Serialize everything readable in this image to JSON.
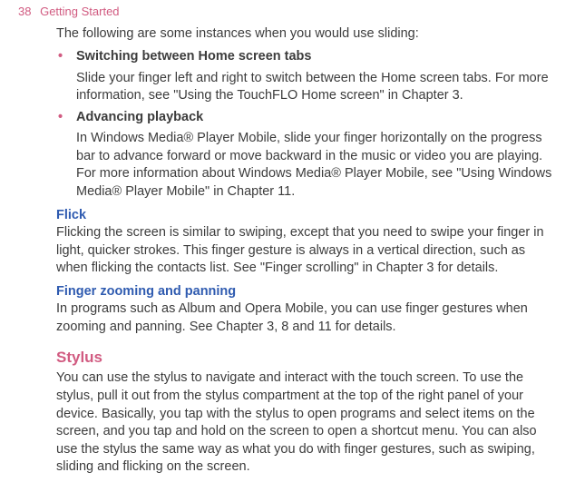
{
  "header": {
    "page_number": "38",
    "section": "Getting Started"
  },
  "intro": "The following are some instances when you would use sliding:",
  "bullets": [
    {
      "title": "Switching between Home screen tabs",
      "body": "Slide your finger left and right to switch between the Home screen tabs. For more information, see \"Using the TouchFLO Home screen\" in Chapter 3."
    },
    {
      "title": "Advancing playback",
      "body": "In Windows Media® Player Mobile, slide your finger horizontally on the progress bar to advance forward or move backward in the music or video you are playing. For more information about Windows Media® Player Mobile, see \"Using Windows Media® Player Mobile\" in Chapter 11."
    }
  ],
  "flick": {
    "heading": "Flick",
    "body": "Flicking the screen is similar to swiping, except that you need to swipe your finger in light, quicker strokes. This finger gesture is always in a vertical direction, such as when flicking the contacts list. See \"Finger scrolling\" in Chapter 3 for details."
  },
  "fzp": {
    "heading": "Finger zooming and panning",
    "body": "In programs such as Album and Opera Mobile, you can use finger gestures when zooming and panning. See Chapter 3, 8 and 11 for details."
  },
  "stylus": {
    "heading": "Stylus",
    "body": "You can use the stylus to navigate and interact with the touch screen. To use the stylus, pull it out from the stylus compartment at the top of the right panel of your device. Basically, you tap with the stylus to open programs and select items on the screen, and you tap and hold on the screen to open a shortcut menu. You can also use the stylus the same way as what you do with finger gestures, such as swiping, sliding and flicking on the screen."
  }
}
